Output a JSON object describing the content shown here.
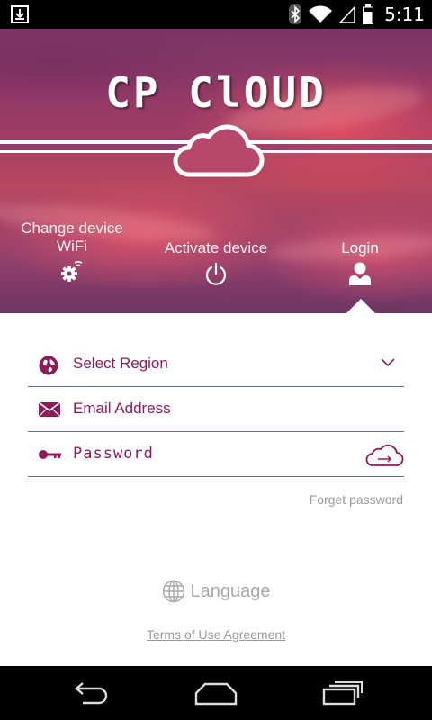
{
  "status_bar": {
    "time": "5:11",
    "icons": [
      "download-icon",
      "bluetooth-icon",
      "wifi-icon",
      "cell-signal-icon",
      "battery-icon"
    ]
  },
  "app": {
    "title": "CP ClOUD",
    "nav": {
      "change_wifi": "Change device WiFi",
      "activate": "Activate device",
      "login": "Login"
    }
  },
  "form": {
    "region_label": "Select Region",
    "email_placeholder": "Email Address",
    "password_placeholder": "Password",
    "forget_password": "Forget password"
  },
  "footer": {
    "language": "Language",
    "terms": "Terms of Use Agreement"
  },
  "colors": {
    "accent": "#8e1a5a",
    "divider": "#b05082",
    "muted": "#9a9a9a"
  }
}
